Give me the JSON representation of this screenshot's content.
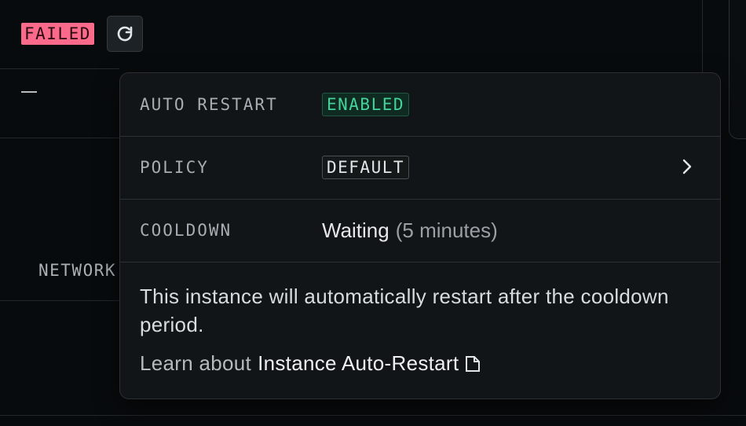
{
  "status": {
    "badge": "FAILED",
    "retry_icon": "refresh-icon"
  },
  "table": {
    "empty_value": "—",
    "network_label": "NETWORK"
  },
  "popover": {
    "rows": [
      {
        "label": "AUTO RESTART",
        "value": "ENABLED"
      },
      {
        "label": "POLICY",
        "value": "DEFAULT"
      },
      {
        "label": "COOLDOWN",
        "value": "Waiting",
        "detail": "(5 minutes)"
      }
    ],
    "description": "This instance will automatically restart after the cooldown period.",
    "learn_prefix": "Learn about",
    "learn_link": "Instance Auto-Restart",
    "learn_icon": "external-link-icon"
  },
  "colors": {
    "failed": "#fb6a8a",
    "enabled": "#44d39a",
    "background": "#080b0d",
    "popover": "#111517"
  }
}
